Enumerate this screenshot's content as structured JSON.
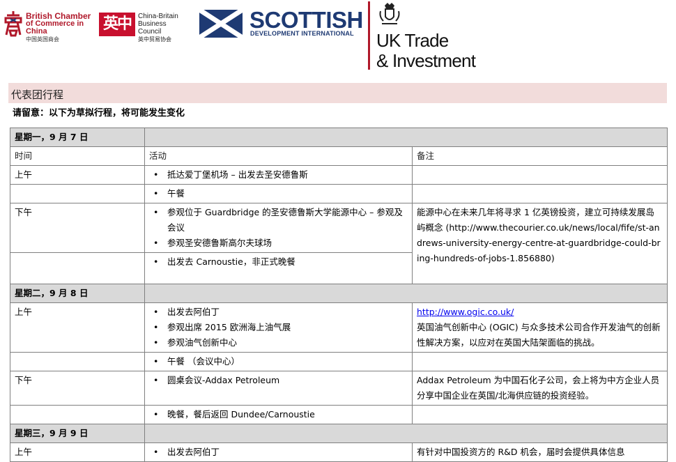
{
  "logos": {
    "bcc": {
      "line1": "British Chamber",
      "line2": "of Commerce in China",
      "line3": "中国英国商会"
    },
    "cbbc": {
      "mark": "英中",
      "line1": "China-Britain",
      "line2": "Business Council",
      "line3": "英中贸易协会"
    },
    "sdi": {
      "word": "SCOTTISH",
      "sub": "DEVELOPMENT INTERNATIONAL"
    },
    "ukti": {
      "line1": "UK Trade",
      "line2": "& Investment"
    }
  },
  "colors": {
    "title_bg": "#f2dcdb",
    "day_bg": "#d9d9d9",
    "brand_red": "#b0182a",
    "sdi_blue": "#1e3a73",
    "link": "#0000ee"
  },
  "title": "代表团行程",
  "note": "请留意：以下为草拟行程，将可能发生变化",
  "headers": {
    "time": "时间",
    "activity": "活动",
    "remarks": "备注"
  },
  "days": [
    {
      "label": "星期一，9 月 7 日",
      "rows": [
        {
          "time": "上午",
          "items": [
            "抵达爱丁堡机场 – 出发去圣安德鲁斯"
          ],
          "remark": ""
        },
        {
          "time": "",
          "items": [
            "午餐"
          ],
          "remark": ""
        },
        {
          "time": "下午",
          "items": [
            "参观位于 Guardbridge 的圣安德鲁斯大学能源中心 – 参观及会议",
            "参观圣安德鲁斯高尔夫球场"
          ],
          "remark": "能源中心在未来几年将寻求 1 亿英镑投资，建立可持续发展岛屿概念 (http://www.thecourier.co.uk/news/local/fife/st-andrews-university-energy-centre-at-guardbridge-could-bring-hundreds-of-jobs-1.856880)"
        },
        {
          "time": "",
          "items": [
            "出发去 Carnoustie，非正式晚餐"
          ]
        }
      ]
    },
    {
      "label": "星期二，9 月 8 日",
      "rows": [
        {
          "time": "上午",
          "items": [
            "出发去阿伯丁",
            "参观出席 2015 欧洲海上油气展",
            "参观油气创新中心"
          ],
          "remark_link": "http://www.ogic.co.uk/",
          "remark": "英国油气创新中心 (OGIC) 与众多技术公司合作开发油气的创新性解决方案，以应对在英国大陆架面临的挑战。"
        },
        {
          "time": "",
          "items": [
            "午餐 （会议中心）"
          ],
          "remark": ""
        },
        {
          "time": "下午",
          "items": [
            "圆桌会议-Addax Petroleum"
          ],
          "remark": "Addax Petroleum 为中国石化子公司，会上将为中方企业人员分享中国企业在英国/北海供应链的投资经验。"
        },
        {
          "time": "",
          "items": [
            "晚餐，餐后返回 Dundee/Carnoustie"
          ],
          "remark": ""
        }
      ]
    },
    {
      "label": "星期三，9 月 9 日",
      "rows": [
        {
          "time": "上午",
          "items": [
            "出发去阿伯丁"
          ],
          "remark": "有针对中国投资方的 R&D 机会，届时会提供具体信息"
        }
      ]
    }
  ]
}
